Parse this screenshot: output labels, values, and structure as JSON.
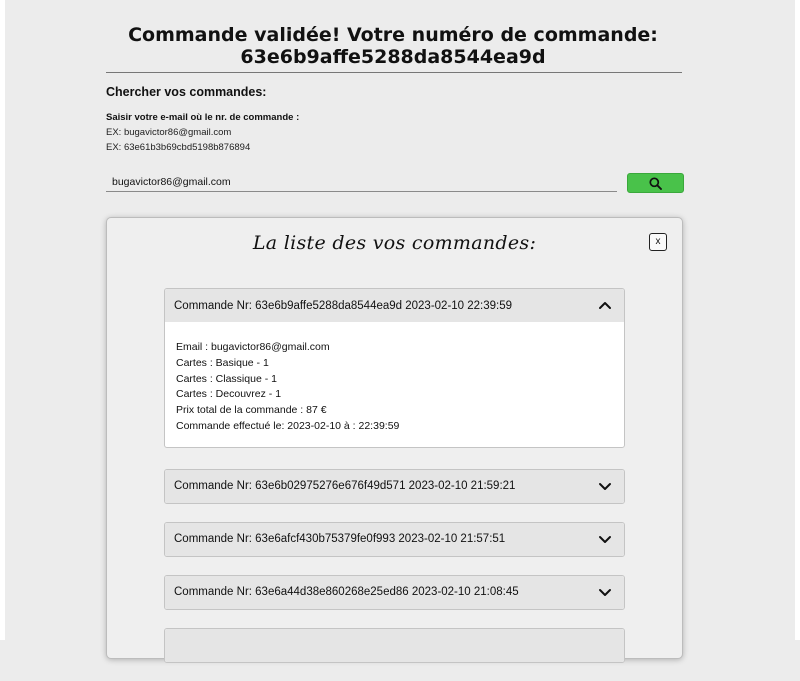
{
  "header": {
    "confirmation": "Commande validée! Votre numéro de commande: 63e6b9affe5288da8544ea9d"
  },
  "search": {
    "title": "Chercher vos commandes:",
    "hint": "Saisir votre e-mail où le nr. de commande :",
    "example1": "EX: bugavictor86@gmail.com",
    "example2": "EX: 63e61b3b69cbd5198b876894",
    "value": "bugavictor86@gmail.com",
    "button_icon": "search-icon",
    "button_color": "#49c24a"
  },
  "modal": {
    "title": "La liste des vos commandes:",
    "close_label": "x",
    "orders": [
      {
        "header": "Commande Nr: 63e6b9affe5288da8544ea9d 2023-02-10 22:39:59",
        "expanded": true,
        "details": [
          "Email : bugavictor86@gmail.com",
          "Cartes : Basique - 1",
          "Cartes : Classique - 1",
          "Cartes : Decouvrez - 1",
          "Prix total de la commande : 87 €",
          "Commande effectué le: 2023-02-10 à : 22:39:59"
        ]
      },
      {
        "header": "Commande Nr: 63e6b02975276e676f49d571 2023-02-10 21:59:21",
        "expanded": false
      },
      {
        "header": "Commande Nr: 63e6afcf430b75379fe0f993 2023-02-10 21:57:51",
        "expanded": false
      },
      {
        "header": "Commande Nr: 63e6a44d38e860268e25ed86 2023-02-10 21:08:45",
        "expanded": false
      }
    ]
  }
}
